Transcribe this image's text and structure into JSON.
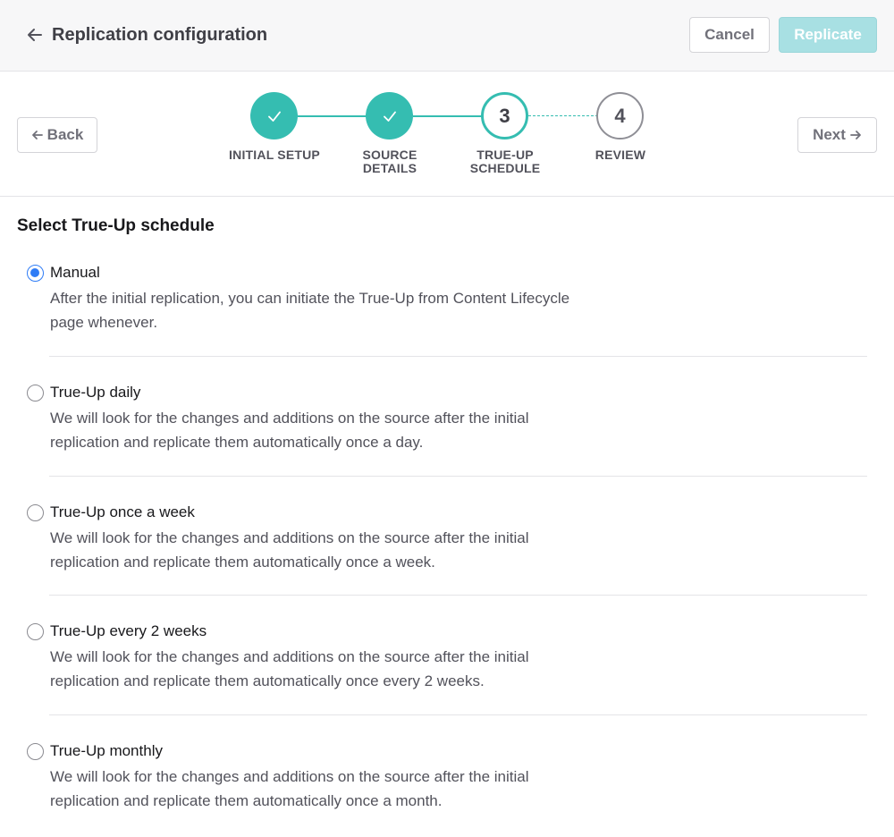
{
  "header": {
    "title": "Replication configuration",
    "cancel_label": "Cancel",
    "replicate_label": "Replicate"
  },
  "stepper": {
    "back_label": "Back",
    "next_label": "Next",
    "steps": [
      {
        "label_line1": "INITIAL SETUP",
        "label_line2": "",
        "state": "done"
      },
      {
        "label_line1": "SOURCE",
        "label_line2": "DETAILS",
        "state": "done"
      },
      {
        "number": "3",
        "label_line1": "TRUE-UP",
        "label_line2": "SCHEDULE",
        "state": "current"
      },
      {
        "number": "4",
        "label_line1": "REVIEW",
        "label_line2": "",
        "state": "future"
      }
    ],
    "accent_color": "#35bdb1"
  },
  "content": {
    "section_title": "Select True-Up schedule",
    "selected": "Manual",
    "options": [
      {
        "label": "Manual",
        "desc_line1": "After the initial replication, you can initiate the True-Up from Content Lifecycle",
        "desc_line2": "page whenever."
      },
      {
        "label": "True-Up daily",
        "desc_line1": "We will look for the changes and additions on the source after the initial",
        "desc_line2": "replication and replicate them automatically once a day."
      },
      {
        "label": "True-Up once a week",
        "desc_line1": "We will look for the changes and additions on the source after the initial",
        "desc_line2": "replication and replicate them automatically once a week."
      },
      {
        "label": "True-Up every 2 weeks",
        "desc_line1": "We will look for the changes and additions on the source after the initial",
        "desc_line2": "replication and replicate them automatically once every 2 weeks."
      },
      {
        "label": "True-Up monthly",
        "desc_line1": "We will look for the changes and additions on the source after the initial",
        "desc_line2": "replication and replicate them automatically once a month."
      }
    ]
  }
}
